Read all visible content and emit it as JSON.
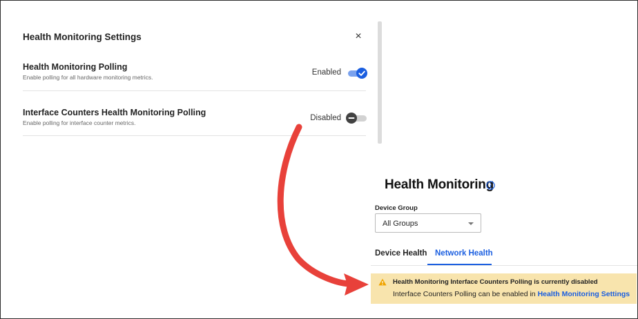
{
  "settings_dialog": {
    "title": "Health Monitoring Settings",
    "close_label": "×",
    "rows": [
      {
        "title": "Health Monitoring Polling",
        "description": "Enable polling for all hardware monitoring metrics.",
        "status": "Enabled",
        "enabled": true
      },
      {
        "title": "Interface Counters Health Monitoring Polling",
        "description": "Enable polling for interface counter metrics.",
        "status": "Disabled",
        "enabled": false
      }
    ]
  },
  "health_page": {
    "title": "Health Monitoring",
    "device_group_label": "Device Group",
    "device_group_value": "All Groups",
    "tabs": [
      {
        "label": "Device Health",
        "active": false
      },
      {
        "label": "Network Health",
        "active": true
      }
    ],
    "alert": {
      "title": "Health Monitoring Interface Counters Polling is currently disabled",
      "text_prefix": "Interface Counters Polling can be enabled in ",
      "link_text": "Health Monitoring Settings"
    }
  },
  "colors": {
    "accent": "#1a5ee0",
    "warning_bg": "#f8e4ad",
    "warning_icon": "#f0a400",
    "arrow": "#e8413a"
  },
  "icons": {
    "close": "close-icon",
    "check": "check-icon",
    "minus": "minus-icon",
    "info": "info-icon",
    "warning": "warning-icon",
    "dropdown": "chevron-down-icon"
  }
}
